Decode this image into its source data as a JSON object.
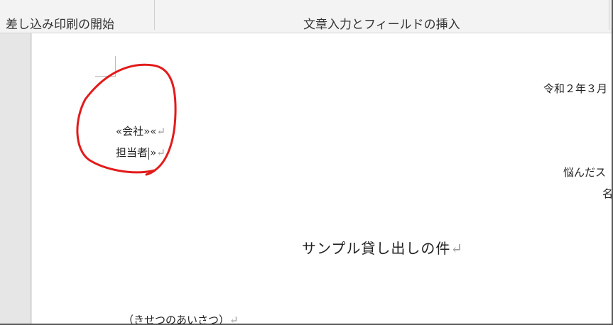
{
  "ribbon": {
    "cut_text": "差し込み印刷の開始　文章入力とフィールドの挿入",
    "group_labels": [
      "差し込み印刷の開始",
      "文章入力とフィールドの挿入"
    ]
  },
  "document": {
    "date_text": "令和２年３月",
    "merge_line1": "«会社»«",
    "merge_line2_a": "担当者",
    "merge_line2_b": "»",
    "paragraph_mark": "↵",
    "sender_line1": "悩んだス",
    "sender_line2": "名",
    "subject": "サンプル貸し出しの件",
    "greeting": "（きせつのあいさつ）"
  },
  "colors": {
    "annotation_stroke": "#e31b1b",
    "ribbon_bg": "#f3f3f3",
    "sidebar_bg": "#e6e6e6"
  }
}
